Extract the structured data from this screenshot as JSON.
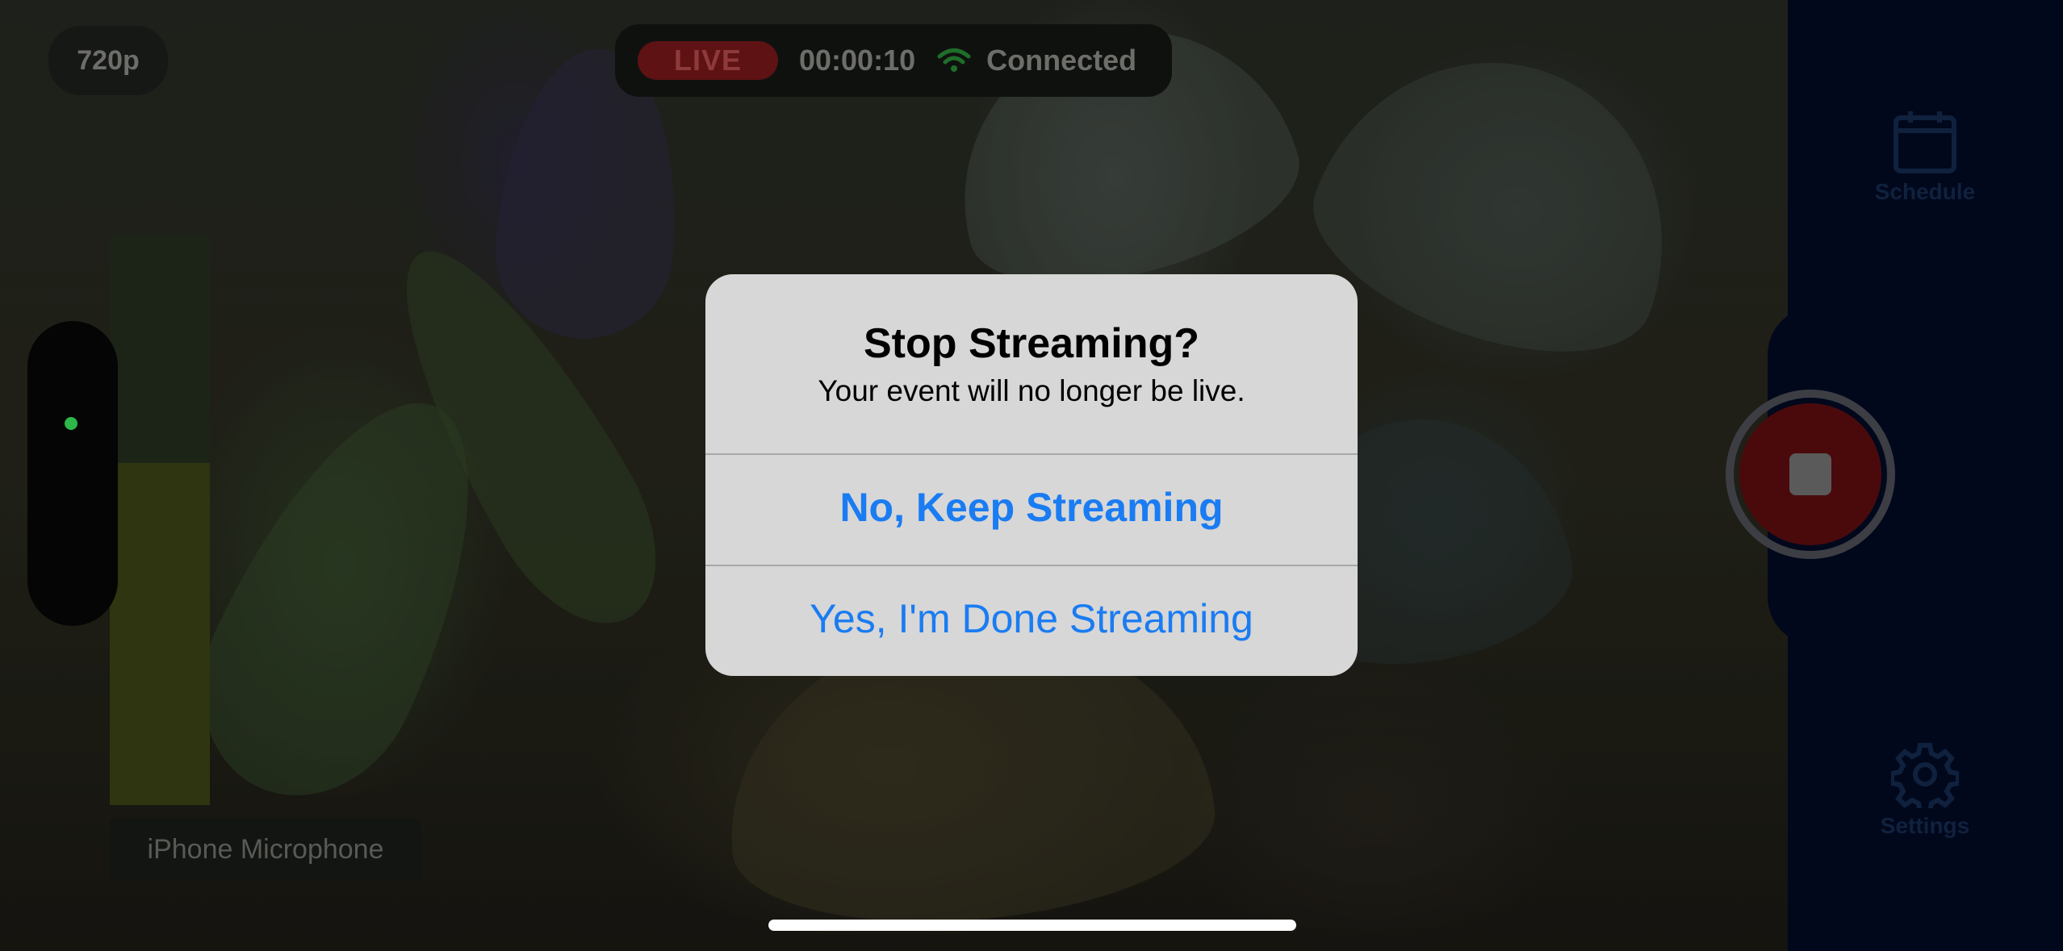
{
  "top_bar": {
    "resolution": "720p",
    "live_label": "LIVE",
    "elapsed_time": "00:00:10",
    "connection_status": "Connected",
    "wifi_icon": "wifi-icon"
  },
  "audio": {
    "input_source": "iPhone Microphone",
    "level_meter_fraction": 0.6,
    "level_color": "#2db84a"
  },
  "right_rail": {
    "schedule_label": "Schedule",
    "settings_label": "Settings",
    "schedule_icon": "calendar-icon",
    "settings_icon": "gear-icon",
    "stop_icon": "stop-icon"
  },
  "alert": {
    "title": "Stop Streaming?",
    "message": "Your event will no longer be live.",
    "primary_button": "No, Keep Streaming",
    "secondary_button": "Yes, I'm Done Streaming",
    "button_color": "#1a7cf2"
  }
}
